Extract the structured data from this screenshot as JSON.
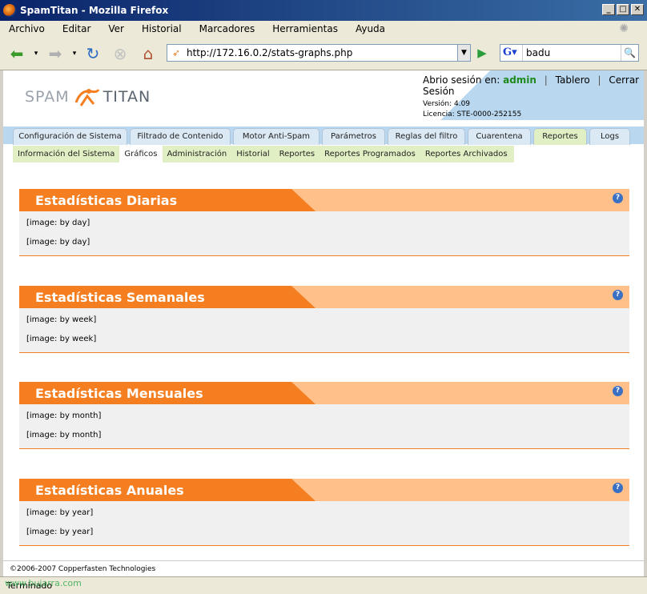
{
  "window": {
    "title": "SpamTitan - Mozilla Firefox",
    "controls": [
      "_",
      "□",
      "✕"
    ]
  },
  "menu": [
    "Archivo",
    "Editar",
    "Ver",
    "Historial",
    "Marcadores",
    "Herramientas",
    "Ayuda"
  ],
  "navbar": {
    "url": "http://172.16.0.2/stats-graphs.php",
    "search_value": "badu"
  },
  "header": {
    "logo_left": "SPAM",
    "logo_right": "TITAN",
    "session_label": "Abrio sesión en:",
    "user": "admin",
    "link_dashboard": "Tablero",
    "link_logout": "Cerrar Sesión",
    "version": "Versión: 4.09",
    "license": "Licencia: STE-0000-252155"
  },
  "tabs": [
    {
      "label": "Configuración de Sistema",
      "active": false
    },
    {
      "label": "Filtrado de Contenido",
      "active": false
    },
    {
      "label": "Motor Anti-Spam",
      "active": false
    },
    {
      "label": "Parámetros",
      "active": false
    },
    {
      "label": "Reglas del filtro",
      "active": false
    },
    {
      "label": "Cuarentena",
      "active": false
    },
    {
      "label": "Reportes",
      "active": true
    },
    {
      "label": "Logs",
      "active": false
    }
  ],
  "subnav": [
    {
      "label": "Información del Sistema",
      "active": false
    },
    {
      "label": "Gráficos",
      "active": true
    },
    {
      "label": "Administración",
      "active": false
    },
    {
      "label": "Historial",
      "active": false
    },
    {
      "label": "Reportes",
      "active": false
    },
    {
      "label": "Reportes Programados",
      "active": false
    },
    {
      "label": "Reportes Archivados",
      "active": false
    }
  ],
  "panels": [
    {
      "title": "Estadísticas Diarias",
      "images": [
        "[image: by day]",
        "[image: by day]"
      ]
    },
    {
      "title": "Estadísticas Semanales",
      "images": [
        "[image: by week]",
        "[image: by week]"
      ]
    },
    {
      "title": "Estadísticas Mensuales",
      "images": [
        "[image: by month]",
        "[image: by month]"
      ]
    },
    {
      "title": "Estadísticas Anuales",
      "images": [
        "[image: by year]",
        "[image: by year]"
      ]
    }
  ],
  "help_glyph": "?",
  "footer": "©2006-2007 Copperfasten Technologies",
  "status": "Terminado",
  "watermark": "www.bujarra.com",
  "colors": {
    "orange": "#f47e20",
    "light_orange": "#ffc08a",
    "blue": "#b9d7ee",
    "green_tab": "#e1f0c4",
    "admin_green": "#1e8a1e"
  }
}
